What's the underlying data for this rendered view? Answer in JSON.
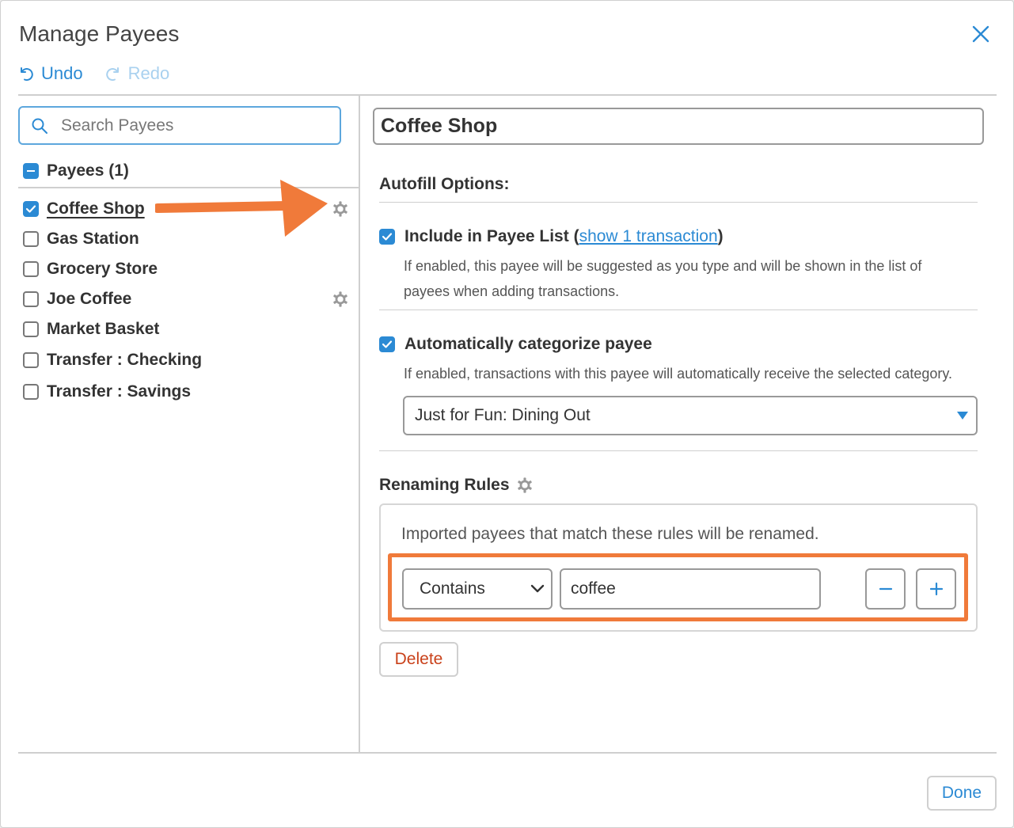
{
  "dialog": {
    "title": "Manage Payees",
    "undo_label": "Undo",
    "redo_label": "Redo"
  },
  "search": {
    "placeholder": "Search Payees",
    "value": ""
  },
  "payees": {
    "group_label": "Payees (1)",
    "items": [
      {
        "name": "Coffee Shop",
        "checked": true,
        "selected": true,
        "has_gear": true
      },
      {
        "name": "Gas Station",
        "checked": false,
        "selected": false,
        "has_gear": false
      },
      {
        "name": "Grocery Store",
        "checked": false,
        "selected": false,
        "has_gear": false
      },
      {
        "name": "Joe Coffee",
        "checked": false,
        "selected": false,
        "has_gear": true
      },
      {
        "name": "Market Basket",
        "checked": false,
        "selected": false,
        "has_gear": false
      },
      {
        "name": "Transfer : Checking",
        "checked": false,
        "selected": false,
        "has_gear": false
      },
      {
        "name": "Transfer : Savings",
        "checked": false,
        "selected": false,
        "has_gear": false
      }
    ]
  },
  "detail": {
    "payee_name": "Coffee Shop",
    "autofill_heading": "Autofill Options:",
    "include_label": "Include in Payee List",
    "include_link": "show 1 transaction",
    "include_checked": true,
    "include_desc_line1": "If enabled, this payee will be suggested as you type and will be shown in the list of",
    "include_desc_line2": "payees when adding transactions.",
    "autocat_label": "Automatically categorize payee",
    "autocat_checked": true,
    "autocat_desc": "If enabled, transactions with this payee will automatically receive the selected category.",
    "category_value": "Just for Fun: Dining Out",
    "renaming_heading": "Renaming Rules",
    "renaming_desc": "Imported payees that match these rules will be renamed.",
    "rule_match": "Contains",
    "rule_text": "coffee",
    "delete_label": "Delete"
  },
  "footer": {
    "done_label": "Done"
  },
  "colors": {
    "accent": "#2b8ad4",
    "highlight": "#f07a3a",
    "danger": "#c9411a"
  }
}
